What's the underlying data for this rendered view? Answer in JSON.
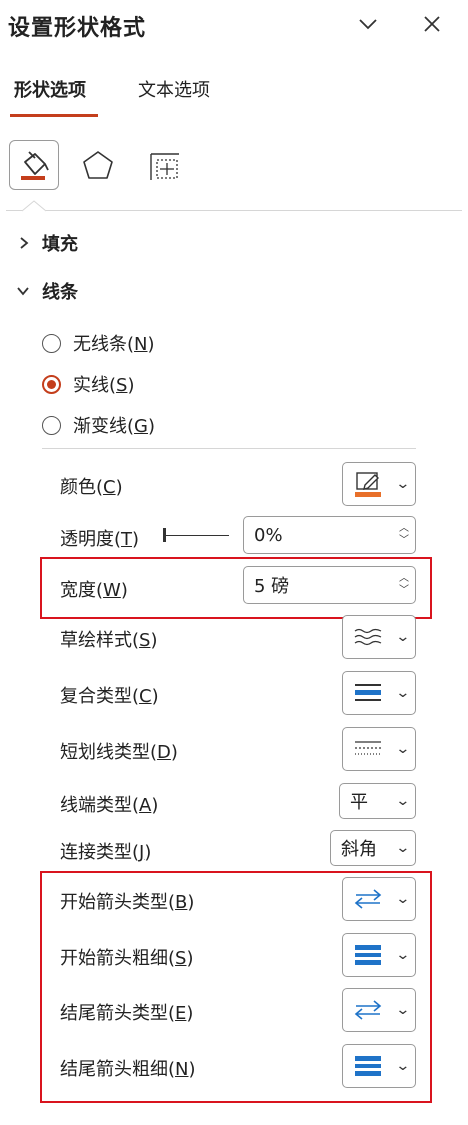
{
  "panel": {
    "title": "设置形状格式",
    "tabs": [
      {
        "label": "形状选项"
      },
      {
        "label": "文本选项"
      }
    ],
    "icons": [
      "fill-line-icon",
      "effects-pentagon-icon",
      "size-properties-icon"
    ]
  },
  "sections": {
    "fill": {
      "label": "填充"
    },
    "line": {
      "label": "线条"
    }
  },
  "line_options": [
    {
      "text": "无线条(",
      "key": "N",
      "end": ")"
    },
    {
      "text": "实线(",
      "key": "S",
      "end": ")"
    },
    {
      "text": "渐变线(",
      "key": "G",
      "end": ")"
    }
  ],
  "props": {
    "color": {
      "text": "颜色(",
      "key": "C",
      "end": ")"
    },
    "transparency": {
      "text": "透明度(",
      "key": "T",
      "end": ")",
      "value": "0%"
    },
    "width": {
      "text": "宽度(",
      "key": "W",
      "end": ")",
      "value": "5 磅"
    },
    "sketch": {
      "text": "草绘样式(",
      "key": "S",
      "end": ")"
    },
    "compound": {
      "text": "复合类型(",
      "key": "C",
      "end": ")"
    },
    "dash": {
      "text": "短划线类型(",
      "key": "D",
      "end": ")"
    },
    "cap": {
      "text": "线端类型(",
      "key": "A",
      "end": ")",
      "value": "平"
    },
    "join": {
      "text": "连接类型(",
      "key": "J",
      "end": ")",
      "value": "斜角"
    },
    "begin_arrow_type": {
      "text": "开始箭头类型(",
      "key": "B",
      "end": ")"
    },
    "begin_arrow_size": {
      "text": "开始箭头粗细(",
      "key": "S",
      "end": ")"
    },
    "end_arrow_type": {
      "text": "结尾箭头类型(",
      "key": "E",
      "end": ")"
    },
    "end_arrow_size": {
      "text": "结尾箭头粗细(",
      "key": "N",
      "end": ")"
    }
  },
  "colors": {
    "accent": "#c43e1c",
    "line_color": "#e8702a",
    "arrow_blue": "#1f73c8",
    "highlight": "#d9141e"
  }
}
